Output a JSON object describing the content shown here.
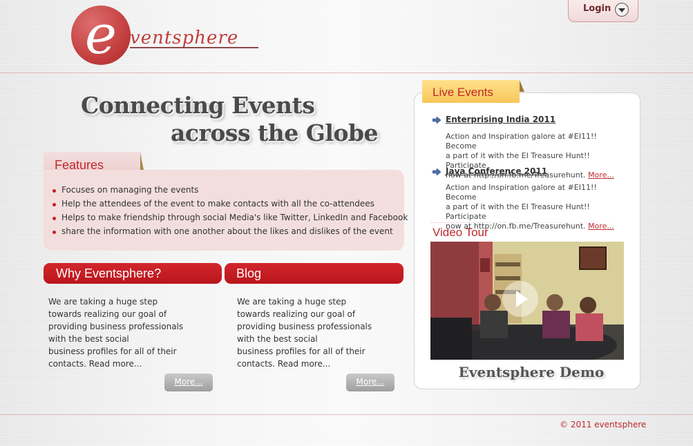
{
  "logo": {
    "letter": "e",
    "word": "ventsphere"
  },
  "header": {
    "login_label": "Login"
  },
  "hero": {
    "line1": "Connecting Events",
    "line2": "across the Globe"
  },
  "features": {
    "title": "Features",
    "items": [
      "Focuses on managing the events",
      "Help the attendees of the event to make contacts with all the co-attendees",
      "Helps to make friendship through social Media's like Twitter, LinkedIn and Facebook",
      "share the information with one another about the likes and dislikes of the event"
    ]
  },
  "why": {
    "title": "Why Eventsphere?",
    "lines": [
      "We are taking a huge step",
      "towards realizing our goal of",
      "providing business professionals",
      "with the best social",
      "business profiles for all of their",
      "contacts. Read more..."
    ],
    "more_label": "More..."
  },
  "blog": {
    "title": "Blog",
    "lines": [
      "We are taking a huge step",
      "towards realizing our goal of",
      "providing business professionals",
      "with the best social",
      "business profiles for all of their",
      "contacts. Read more..."
    ],
    "more_label": "More..."
  },
  "live_events": {
    "title": "Live Events",
    "events": [
      {
        "title": "Enterprising India 2011",
        "lines": [
          "Action and Inspiration galore at #EI11!! Become",
          "a part of it with the EI Treasure Hunt!! Participate",
          "now at http://on.fb.me/Treasurehunt."
        ],
        "more": "More..."
      },
      {
        "title": "Java Conference 2011",
        "lines": [
          "Action and Inspiration galore at #EI11!! Become",
          "a part of it with the EI Treasure Hunt!! Participate",
          "now at http://on.fb.me/Treasurehunt."
        ],
        "more": "More..."
      }
    ]
  },
  "video": {
    "title": "Video Tour",
    "caption": "Eventsphere Demo"
  },
  "footer": {
    "copyright": "© 2011 eventsphere"
  },
  "colors": {
    "brand_red": "#c0282d",
    "tab_yellow": "#f7c75a",
    "feature_bg": "#f3dede"
  }
}
